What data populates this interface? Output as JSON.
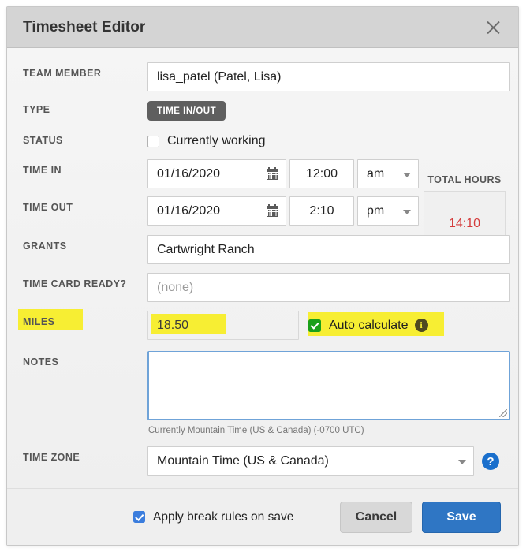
{
  "dialog": {
    "title": "Timesheet Editor",
    "close_icon": "close-icon"
  },
  "fields": {
    "team_member": {
      "label": "TEAM MEMBER",
      "value": "lisa_patel (Patel, Lisa)"
    },
    "type": {
      "label": "TYPE",
      "value": "TIME IN/OUT"
    },
    "status": {
      "label": "STATUS",
      "checkbox_label": "Currently working",
      "checked": false
    },
    "time_in": {
      "label": "TIME IN",
      "date": "01/16/2020",
      "time": "12:00",
      "meridiem": "am",
      "calendar_icon": "calendar-icon"
    },
    "time_out": {
      "label": "TIME OUT",
      "date": "01/16/2020",
      "time": "2:10",
      "meridiem": "pm",
      "calendar_icon": "calendar-icon"
    },
    "total_hours": {
      "label": "TOTAL HOURS",
      "value": "14:10",
      "color": "#d43b3b"
    },
    "grants": {
      "label": "GRANTS",
      "value": "Cartwright Ranch"
    },
    "time_card_ready": {
      "label": "TIME CARD READY?",
      "placeholder": "(none)",
      "value": ""
    },
    "miles": {
      "label": "MILES",
      "value": "18.50",
      "auto_calculate_label": "Auto calculate",
      "auto_calculate_checked": true,
      "info_icon": "info-icon",
      "highlight_color": "#f7ee33"
    },
    "notes": {
      "label": "NOTES",
      "value": "",
      "helper_text": "Currently Mountain Time (US & Canada) (-0700 UTC)"
    },
    "time_zone": {
      "label": "TIME ZONE",
      "value": "Mountain Time (US & Canada)",
      "help_icon": "help-icon",
      "dropdown_icon": "chevron-down-icon"
    }
  },
  "footer": {
    "apply_break_rules_label": "Apply break rules on save",
    "apply_break_rules_checked": true,
    "cancel_label": "Cancel",
    "save_label": "Save"
  }
}
